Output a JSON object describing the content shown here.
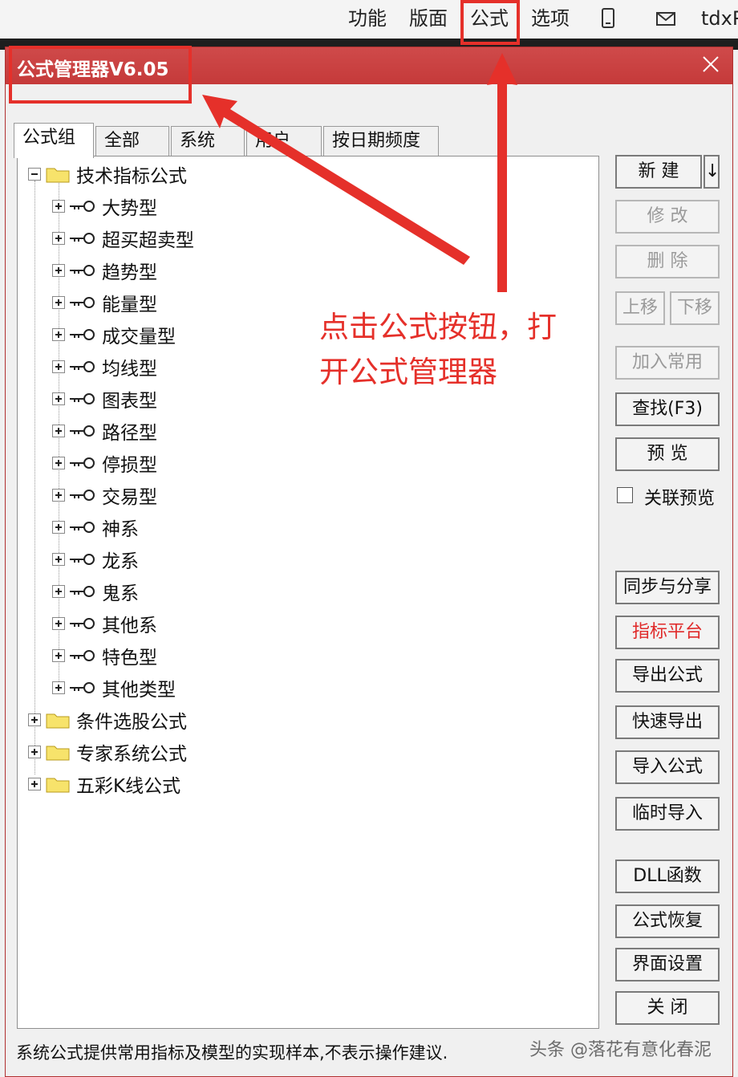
{
  "menubar": {
    "items": [
      "功能",
      "版面",
      "公式",
      "选项"
    ],
    "right_text": "tdxP"
  },
  "dialog": {
    "title": "公式管理器V6.05",
    "tabs": [
      "公式组",
      "全部",
      "系统",
      "用户",
      "按日期频度"
    ],
    "tree": {
      "root": "技术指标公式",
      "children": [
        "大势型",
        "超买超卖型",
        "趋势型",
        "能量型",
        "成交量型",
        "均线型",
        "图表型",
        "路径型",
        "停损型",
        "交易型",
        "神系",
        "龙系",
        "鬼系",
        "其他系",
        "特色型",
        "其他类型"
      ],
      "siblings": [
        "条件选股公式",
        "专家系统公式",
        "五彩K线公式"
      ]
    },
    "buttons": {
      "new": "新 建",
      "new_arrow": "↓",
      "modify": "修 改",
      "delete": "删 除",
      "move_up": "上移",
      "move_down": "下移",
      "add_common": "加入常用",
      "find": "查找(F3)",
      "preview": "预 览",
      "link_preview": "关联预览",
      "sync_share": "同步与分享",
      "indicator_platform": "指标平台",
      "export": "导出公式",
      "quick_export": "快速导出",
      "import": "导入公式",
      "temp_import": "临时导入",
      "dll": "DLL函数",
      "restore": "公式恢复",
      "ui_settings": "界面设置",
      "close": "关 闭"
    },
    "status": "系统公式提供常用指标及模型的实现样本,不表示操作建议."
  },
  "annotation": {
    "line1": "点击公式按钮，打",
    "line2": "开公式管理器",
    "color": "#e5302a"
  },
  "watermark": "头条 @落花有意化春泥",
  "colors": {
    "titlebar": "#c94141",
    "highlight": "#e5302a",
    "platform_text": "#e02a2a"
  }
}
